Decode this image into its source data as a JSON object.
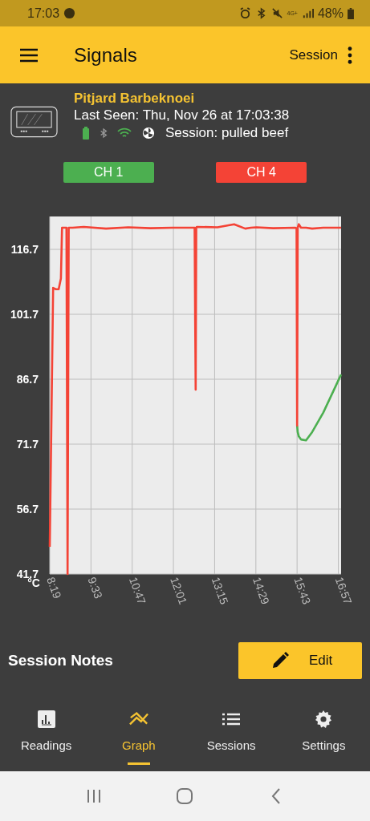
{
  "status_bar": {
    "time": "17:03",
    "network": "4G+",
    "battery": "48%"
  },
  "app_bar": {
    "title": "Signals",
    "action": "Session"
  },
  "device": {
    "name": "Pitjard Barbeknoei",
    "last_seen": "Last Seen: Thu, Nov 26 at 17:03:38",
    "session": "Session: pulled beef"
  },
  "chart_data": {
    "type": "line",
    "grid": true,
    "ylabel": "°C",
    "xlim": [
      499,
      1022
    ],
    "ylim": [
      41.7,
      124.3
    ],
    "yticks": [
      41.7,
      56.7,
      71.7,
      86.7,
      101.7,
      116.7
    ],
    "xticks": [
      {
        "value": 499,
        "label": "8:19"
      },
      {
        "value": 573,
        "label": "9:33"
      },
      {
        "value": 647,
        "label": "10:47"
      },
      {
        "value": 721,
        "label": "12:01"
      },
      {
        "value": 795,
        "label": "13:15"
      },
      {
        "value": 869,
        "label": "14:29"
      },
      {
        "value": 943,
        "label": "15:43"
      },
      {
        "value": 1017,
        "label": "16:57"
      }
    ],
    "x": [
      499,
      505,
      510,
      515,
      519,
      521,
      527,
      529,
      531,
      533,
      540,
      560,
      600,
      640,
      680,
      720,
      759,
      760,
      761,
      762,
      763,
      800,
      830,
      850,
      860,
      870,
      900,
      940,
      942,
      943,
      944,
      946,
      950,
      959,
      970,
      990,
      1010,
      1022
    ],
    "series": [
      {
        "name": "CH 1",
        "color": "#4caf50",
        "values": [
          null,
          null,
          null,
          null,
          null,
          null,
          null,
          null,
          null,
          null,
          null,
          null,
          null,
          null,
          null,
          null,
          null,
          null,
          null,
          null,
          null,
          null,
          null,
          null,
          null,
          null,
          null,
          null,
          null,
          76,
          74.5,
          73.5,
          72.8,
          72.6,
          74.5,
          79,
          84.5,
          87.8
        ]
      },
      {
        "name": "CH 4",
        "color": "#f44336",
        "values": [
          48,
          107.8,
          107.5,
          107.5,
          110,
          121.7,
          121.7,
          121.7,
          41.7,
          121.7,
          121.7,
          121.9,
          121.5,
          121.8,
          121.6,
          121.7,
          121.7,
          100,
          84.3,
          121.7,
          121.9,
          121.8,
          122.5,
          121.5,
          121.7,
          121.8,
          121.6,
          121.7,
          121.5,
          76,
          121.7,
          122.5,
          121.7,
          121.7,
          121.5,
          121.7,
          121.7,
          121.7
        ]
      }
    ]
  },
  "session_notes": {
    "title": "Session Notes",
    "button": "Edit"
  },
  "nav": [
    {
      "label": "Readings",
      "selected": false
    },
    {
      "label": "Graph",
      "selected": true
    },
    {
      "label": "Sessions",
      "selected": false
    },
    {
      "label": "Settings",
      "selected": false
    }
  ]
}
